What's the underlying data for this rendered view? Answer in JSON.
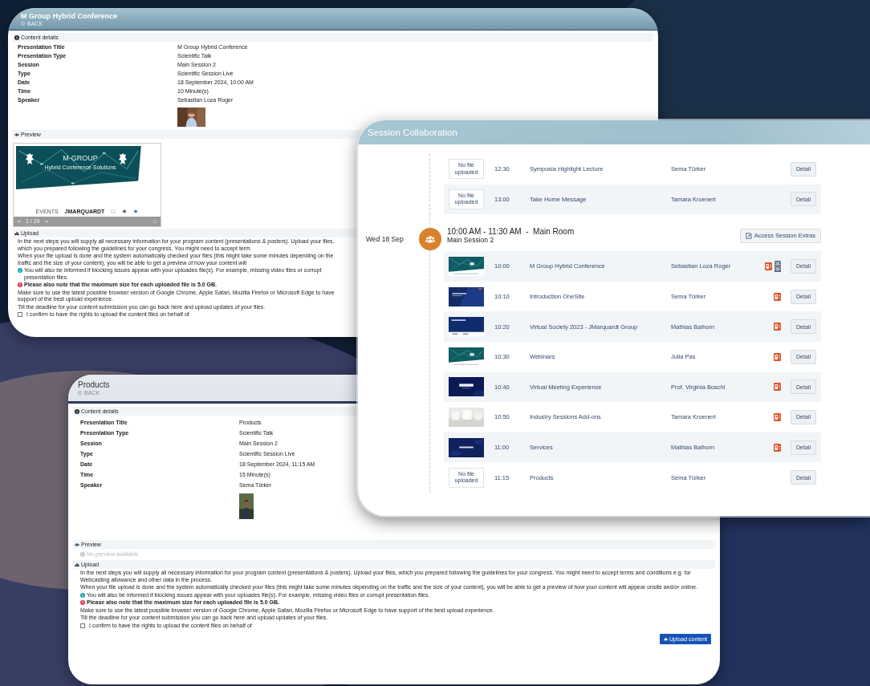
{
  "conference_window": {
    "title": "M Group Hybrid Conference",
    "back": "BACK",
    "details_heading": "Content details",
    "details": [
      {
        "label": "Presentation Title",
        "value": "M Group Hybrid Conference"
      },
      {
        "label": "Presentation Type",
        "value": "Scientific Talk"
      },
      {
        "label": "Session",
        "value": "Main Session 2"
      },
      {
        "label": "Type",
        "value": "Scientific Session Live"
      },
      {
        "label": "Date",
        "value": "18 September 2024, 10:00 AM"
      },
      {
        "label": "Time",
        "value": "10 Minute(s)"
      },
      {
        "label": "Speaker",
        "value": "Sebastian Loza Roger"
      }
    ],
    "preview_heading": "Preview",
    "preview": {
      "kind": "slide",
      "headline": "M-GROUP",
      "subtitle": "Hybrid Conference Solutions",
      "logos": [
        "EVENTS",
        "JMARQUARDT"
      ],
      "page": "1 / 24"
    },
    "upload_heading": "Upload",
    "paragraphs": [
      {
        "kind": "text",
        "text": "In the next steps you will supply all necessary information for your program content (presentations & posters). Upload your files, which you prepared following the guidelines for your congress. You might need to accept term"
      },
      {
        "kind": "text",
        "text": "When your file upload is done and the system automatically checked your files (this might take some minutes depending on the traffic and the size of your content), you will be able to get a preview of how your content will"
      },
      {
        "kind": "info",
        "text": "You will also be informed if blocking issues appear with your uploades file(s). For example, missing video files or corrupt presentation files."
      },
      {
        "kind": "warning",
        "text": "Please also note that the maximum size for each uploaded file is 5.0 GB."
      },
      {
        "kind": "text",
        "text": "Make sure to use the latest possible browser version of Google Chrome, Apple Safari, Mozilla Firefox or Microsoft Edge to have support of the best upload experience."
      },
      {
        "kind": "text",
        "text": "Till the deadline for your content submission you can go back here and upload updates of your files."
      }
    ],
    "confirm": {
      "label": "I confirm to have the rights to upload the content files on behalf of",
      "checked": false
    }
  },
  "products_window": {
    "title": "Products",
    "back": "BACK",
    "details_heading": "Content details",
    "details": [
      {
        "label": "Presentation Title",
        "value": "Products"
      },
      {
        "label": "Presentation Type",
        "value": "Scientific Talk"
      },
      {
        "label": "Session",
        "value": "Main Session 2"
      },
      {
        "label": "Type",
        "value": "Scientific Session Live"
      },
      {
        "label": "Date",
        "value": "18 September 2024, 11:15 AM"
      },
      {
        "label": "Time",
        "value": "15 Minute(s)"
      },
      {
        "label": "Speaker",
        "value": "Sema Türker"
      }
    ],
    "preview_heading": "Preview",
    "preview": {
      "kind": "none",
      "text": "No preview available"
    },
    "upload_heading": "Upload",
    "paragraphs": [
      {
        "kind": "text",
        "text": "In the next steps you will supply all necessary information for your program content (presentations & posters). Upload your files, which you prepared following the guidelines for your congress. You might need to accept terms and conditions e.g. for Webcasting allowance and other data in the process."
      },
      {
        "kind": "text",
        "text": "When your file upload is done and the system automatically checked your files (this might take some minutes depending on the traffic and the size of your content), you will be able to get a preview of how your content will appear onsite and/or online."
      },
      {
        "kind": "info",
        "text": "You will also be informed if blocking issues appear with your uploades file(s). For example, missing video files or corrupt presentation files."
      },
      {
        "kind": "warning",
        "text": "Please also note that the maximum size for each uploaded file is 5.0 GB."
      },
      {
        "kind": "text",
        "text": "Make sure to use the latest possible browser version of Google Chrome, Apple Safari, Mozilla Firefox or Microsoft Edge to have support of the best upload experience."
      },
      {
        "kind": "text",
        "text": "Till the deadline for your content submission you can go back here and upload updates of your files."
      }
    ],
    "confirm": {
      "label": "I confirm to have the rights to upload the content files on behalf of",
      "checked": false
    },
    "upload_button": "Upload content"
  },
  "session_window": {
    "title": "Session Collaboration",
    "blocks": [
      {
        "rows": [
          {
            "thumb": {
              "kind": "none",
              "text": "No file uploaded"
            },
            "time": "12:30",
            "title": "Symposia Highlight Lecture",
            "speaker": "Sema Türker",
            "slides": false,
            "video": false,
            "action": "Detail"
          },
          {
            "thumb": {
              "kind": "none",
              "text": "No file uploaded"
            },
            "time": "13:00",
            "title": "Take Home Message",
            "speaker": "Tamara Kroenert",
            "slides": false,
            "video": false,
            "action": "Detail"
          }
        ]
      },
      {
        "day": "Wed 18 Sep",
        "heading": "10:00 AM - 11:30 AM  -  Main Room",
        "session": "Main Session 2",
        "extras_button": "Access Session Extras",
        "rows": [
          {
            "time": "10:00",
            "title": "M Group Hybrid Conference",
            "speaker": "Sebastian Loza Roger",
            "slides": true,
            "video": true,
            "action": "Detail"
          },
          {
            "time": "10:10",
            "title": "Introduction OneSite",
            "speaker": "Sema Türker",
            "slides": true,
            "video": false,
            "action": "Detail"
          },
          {
            "time": "10:20",
            "title": "Virtual Society 2023 - JMarquardt Group",
            "speaker": "Mathias Balhorn",
            "slides": true,
            "video": false,
            "action": "Detail"
          },
          {
            "time": "10:30",
            "title": "Webinars",
            "speaker": "Julia Pas",
            "slides": true,
            "video": false,
            "action": "Detail"
          },
          {
            "time": "10:40",
            "title": "Virtual Meeting Experience",
            "speaker": "Prof. Virginia Boschi",
            "slides": true,
            "video": false,
            "action": "Detail"
          },
          {
            "time": "10:50",
            "title": "Industry Sessions Add-ons",
            "speaker": "Tamara Kroenert",
            "slides": true,
            "video": false,
            "action": "Detail"
          },
          {
            "time": "11:00",
            "title": "Services",
            "speaker": "Mathias Balhorn",
            "slides": true,
            "video": false,
            "action": "Detail"
          },
          {
            "thumb": {
              "kind": "none",
              "text": "No file uploaded"
            },
            "time": "11:15",
            "title": "Products",
            "speaker": "Sema Türker",
            "slides": false,
            "video": false,
            "action": "Detail"
          }
        ]
      }
    ]
  }
}
